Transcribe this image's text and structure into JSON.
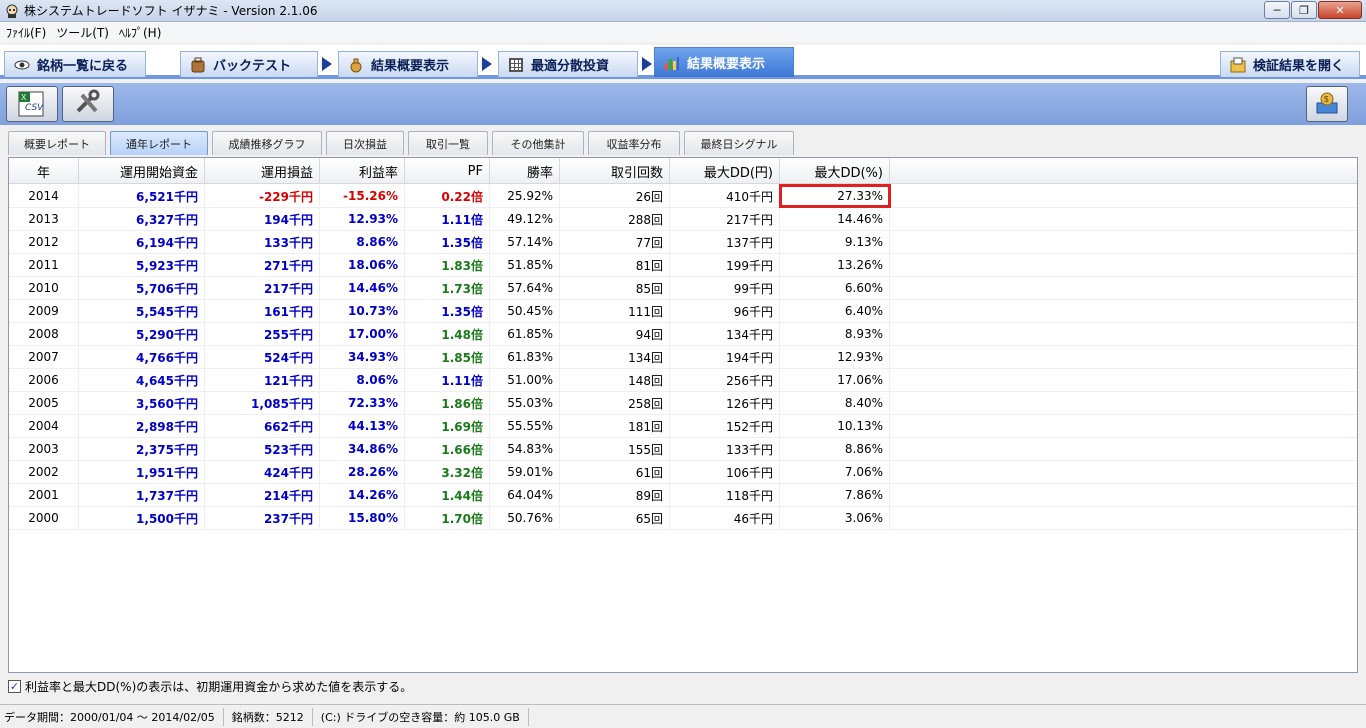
{
  "window": {
    "title": "株システムトレードソフト イザナミ - Version 2.1.06",
    "minimize": "─",
    "maximize": "❐",
    "close": "✕"
  },
  "menu": [
    "ﾌｧｲﾙ(F)",
    "ツール(T)",
    "ﾍﾙﾌﾟ(H)"
  ],
  "nav": {
    "back": "銘柄一覧に戻る",
    "backtest": "バックテスト",
    "summary1": "結果概要表示",
    "optimize": "最適分散投資",
    "summary2": "結果概要表示",
    "open_results": "検証結果を開く"
  },
  "toolbar": {
    "csv_label": "CSV"
  },
  "subtabs": [
    "概要レポート",
    "通年レポート",
    "成績推移グラフ",
    "日次損益",
    "取引一覧",
    "その他集計",
    "収益率分布",
    "最終日シグナル"
  ],
  "table": {
    "headers": [
      "年",
      "運用開始資金",
      "運用損益",
      "利益率",
      "PF",
      "勝率",
      "取引回数",
      "最大DD(円)",
      "最大DD(%)"
    ],
    "rows": [
      [
        "2014",
        "6,521千円",
        "-229千円",
        "-15.26%",
        "0.22倍",
        "25.92%",
        "26回",
        "410千円",
        "27.33%"
      ],
      [
        "2013",
        "6,327千円",
        "194千円",
        "12.93%",
        "1.11倍",
        "49.12%",
        "288回",
        "217千円",
        "14.46%"
      ],
      [
        "2012",
        "6,194千円",
        "133千円",
        "8.86%",
        "1.35倍",
        "57.14%",
        "77回",
        "137千円",
        "9.13%"
      ],
      [
        "2011",
        "5,923千円",
        "271千円",
        "18.06%",
        "1.83倍",
        "51.85%",
        "81回",
        "199千円",
        "13.26%"
      ],
      [
        "2010",
        "5,706千円",
        "217千円",
        "14.46%",
        "1.73倍",
        "57.64%",
        "85回",
        "99千円",
        "6.60%"
      ],
      [
        "2009",
        "5,545千円",
        "161千円",
        "10.73%",
        "1.35倍",
        "50.45%",
        "111回",
        "96千円",
        "6.40%"
      ],
      [
        "2008",
        "5,290千円",
        "255千円",
        "17.00%",
        "1.48倍",
        "61.85%",
        "94回",
        "134千円",
        "8.93%"
      ],
      [
        "2007",
        "4,766千円",
        "524千円",
        "34.93%",
        "1.85倍",
        "61.83%",
        "134回",
        "194千円",
        "12.93%"
      ],
      [
        "2006",
        "4,645千円",
        "121千円",
        "8.06%",
        "1.11倍",
        "51.00%",
        "148回",
        "256千円",
        "17.06%"
      ],
      [
        "2005",
        "3,560千円",
        "1,085千円",
        "72.33%",
        "1.86倍",
        "55.03%",
        "258回",
        "126千円",
        "8.40%"
      ],
      [
        "2004",
        "2,898千円",
        "662千円",
        "44.13%",
        "1.69倍",
        "55.55%",
        "181回",
        "152千円",
        "10.13%"
      ],
      [
        "2003",
        "2,375千円",
        "523千円",
        "34.86%",
        "1.66倍",
        "54.83%",
        "155回",
        "133千円",
        "8.86%"
      ],
      [
        "2002",
        "1,951千円",
        "424千円",
        "28.26%",
        "3.32倍",
        "59.01%",
        "61回",
        "106千円",
        "7.06%"
      ],
      [
        "2001",
        "1,737千円",
        "214千円",
        "14.26%",
        "1.44倍",
        "64.04%",
        "89回",
        "118千円",
        "7.86%"
      ],
      [
        "2000",
        "1,500千円",
        "237千円",
        "15.80%",
        "1.70倍",
        "50.76%",
        "65回",
        "46千円",
        "3.06%"
      ]
    ]
  },
  "footer": {
    "checkbox_label": "利益率と最大DD(%)の表示は、初期運用資金から求めた値を表示する。",
    "checked": "✓"
  },
  "status": {
    "period": "データ期間：2000/01/04 〜 2014/02/05",
    "count": "銘柄数：5212",
    "disk": "(C:) ドライブの空き容量：約 105.0 GB"
  },
  "colors": {
    "positive": "#0000c8",
    "negative": "#d80000",
    "pf_good": "#1a7a1a",
    "highlight": "#e02020",
    "nav_active": "#3e78d6"
  }
}
